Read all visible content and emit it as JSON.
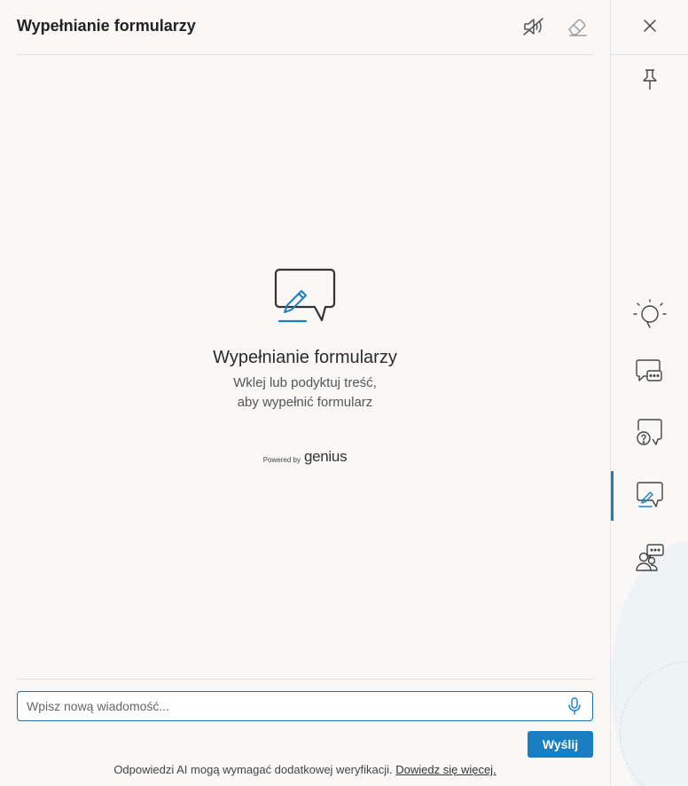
{
  "header": {
    "title": "Wypełnianie formularzy",
    "mute_icon": "speaker-muted-icon",
    "clear_icon": "eraser-icon"
  },
  "empty_state": {
    "icon": "chat-pencil-icon",
    "title": "Wypełnianie formularzy",
    "description_line1": "Wklej lub podyktuj treść,",
    "description_line2": "aby wypełnić formularz",
    "powered_by": "Powered by",
    "brand": "genius"
  },
  "composer": {
    "placeholder": "Wpisz nową wiadomość...",
    "value": "",
    "mic_icon": "microphone-icon",
    "send_label": "Wyślij"
  },
  "footer": {
    "disclaimer": "Odpowiedzi AI mogą wymagać dodatkowej weryfikacji.",
    "learn_more": "Dowiedz się więcej."
  },
  "sidebar": {
    "items": [
      {
        "name": "close-icon"
      },
      {
        "name": "pin-icon"
      },
      {
        "name": "lightbulb-icon"
      },
      {
        "name": "chat-icon"
      },
      {
        "name": "question-chat-icon"
      },
      {
        "name": "form-fill-chat-icon",
        "active": true
      },
      {
        "name": "people-chat-icon"
      }
    ]
  },
  "colors": {
    "accent": "#1a7ec2",
    "background": "#f9f8f7",
    "icon": "#333333"
  }
}
